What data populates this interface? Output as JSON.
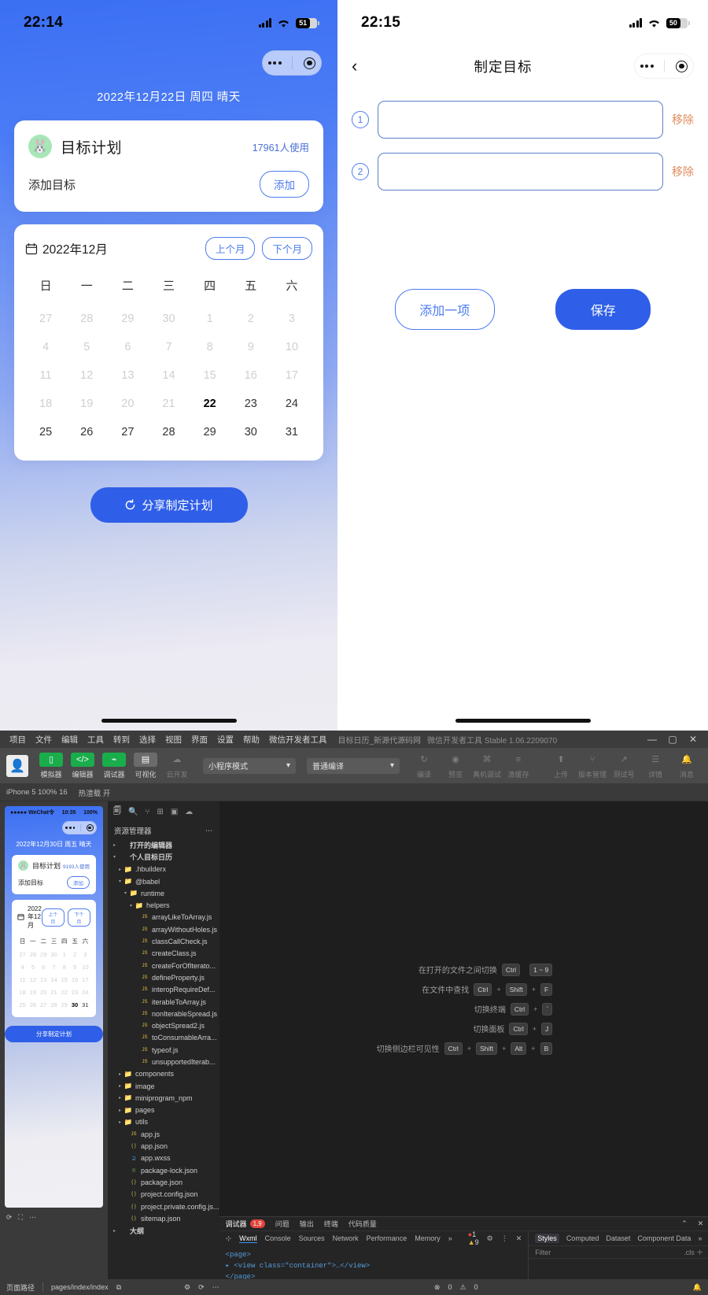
{
  "phone_left": {
    "status": {
      "time": "22:14",
      "battery": "51",
      "signal_icon": "signal-bars-icon",
      "wifi_icon": "wifi-icon"
    },
    "capsule": {
      "menu_icon": "more-dots-icon",
      "target_icon": "target-circle-icon"
    },
    "date_line": "2022年12月22日 周四 晴天",
    "goal_card": {
      "avatar_icon": "rabbit-avatar-icon",
      "title": "目标计划",
      "users": "17961人使用",
      "row_label": "添加目标",
      "add_button": "添加"
    },
    "calendar": {
      "icon": "calendar-icon",
      "month_label": "2022年12月",
      "prev_button": "上个月",
      "next_button": "下个月",
      "weekdays": [
        "日",
        "一",
        "二",
        "三",
        "四",
        "五",
        "六"
      ],
      "weeks": [
        [
          {
            "d": "27",
            "s": "muted"
          },
          {
            "d": "28",
            "s": "muted"
          },
          {
            "d": "29",
            "s": "muted"
          },
          {
            "d": "30",
            "s": "muted"
          },
          {
            "d": "1",
            "s": "muted"
          },
          {
            "d": "2",
            "s": "muted"
          },
          {
            "d": "3",
            "s": "muted"
          }
        ],
        [
          {
            "d": "4",
            "s": "muted"
          },
          {
            "d": "5",
            "s": "muted"
          },
          {
            "d": "6",
            "s": "muted"
          },
          {
            "d": "7",
            "s": "muted"
          },
          {
            "d": "8",
            "s": "muted"
          },
          {
            "d": "9",
            "s": "muted"
          },
          {
            "d": "10",
            "s": "muted"
          }
        ],
        [
          {
            "d": "11",
            "s": "muted"
          },
          {
            "d": "12",
            "s": "muted"
          },
          {
            "d": "13",
            "s": "muted"
          },
          {
            "d": "14",
            "s": "muted"
          },
          {
            "d": "15",
            "s": "muted"
          },
          {
            "d": "16",
            "s": "muted"
          },
          {
            "d": "17",
            "s": "muted"
          }
        ],
        [
          {
            "d": "18",
            "s": "muted"
          },
          {
            "d": "19",
            "s": "muted"
          },
          {
            "d": "20",
            "s": "muted"
          },
          {
            "d": "21",
            "s": "muted"
          },
          {
            "d": "22",
            "s": "today"
          },
          {
            "d": "23",
            "s": ""
          },
          {
            "d": "24",
            "s": ""
          }
        ],
        [
          {
            "d": "25",
            "s": ""
          },
          {
            "d": "26",
            "s": ""
          },
          {
            "d": "27",
            "s": ""
          },
          {
            "d": "28",
            "s": ""
          },
          {
            "d": "29",
            "s": ""
          },
          {
            "d": "30",
            "s": ""
          },
          {
            "d": "31",
            "s": ""
          }
        ]
      ]
    },
    "share_button": {
      "label": "分享制定计划",
      "icon": "refresh-icon"
    },
    "home_indicator": "home-indicator"
  },
  "phone_right": {
    "status": {
      "time": "22:15",
      "battery": "50",
      "signal_icon": "signal-bars-icon",
      "wifi_icon": "wifi-icon"
    },
    "nav": {
      "back_icon": "chevron-left-icon",
      "title": "制定目标",
      "menu_icon": "more-dots-icon",
      "target_icon": "target-circle-icon"
    },
    "goals": [
      {
        "number": "①",
        "value": "",
        "placeholder": "",
        "remove_label": "移除"
      },
      {
        "number": "②",
        "value": "",
        "placeholder": "",
        "remove_label": "移除"
      }
    ],
    "add_item_button": "添加一项",
    "save_button": "保存",
    "home_indicator": "home-indicator"
  },
  "ide": {
    "menubar": {
      "items": [
        "项目",
        "文件",
        "编辑",
        "工具",
        "转到",
        "选择",
        "视图",
        "界面",
        "设置",
        "帮助",
        "微信开发者工具"
      ],
      "project_name": "目标日历_新源代源码网",
      "window_title": "微信开发者工具 Stable 1.06.2209070",
      "minimize": "—",
      "maximize": "▢",
      "close": "✕"
    },
    "toolbar": {
      "avatar_icon": "user-avatar-icon",
      "left_items": [
        {
          "label": "模拟器",
          "icon": "phone-icon",
          "style": "green",
          "glyph": "▯"
        },
        {
          "label": "编辑器",
          "icon": "code-icon",
          "style": "green",
          "glyph": "</>"
        },
        {
          "label": "调试器",
          "icon": "debug-icon",
          "style": "green",
          "glyph": "⌁"
        },
        {
          "label": "可视化",
          "icon": "layout-icon",
          "style": "grey",
          "glyph": "▤"
        },
        {
          "label": "云开发",
          "icon": "cloud-icon",
          "style": "flat",
          "glyph": "☁"
        }
      ],
      "mode_select": "小程序模式",
      "compile_select": "普通编译",
      "mid_items": [
        {
          "label": "编译",
          "icon": "compile-refresh-icon",
          "glyph": "↻"
        },
        {
          "label": "预览",
          "icon": "preview-eye-icon",
          "glyph": "◉"
        },
        {
          "label": "真机调试",
          "icon": "device-debug-icon",
          "glyph": "⌘"
        },
        {
          "label": "清缓存",
          "icon": "clear-cache-icon",
          "glyph": "≡"
        }
      ],
      "right_items": [
        {
          "label": "上传",
          "icon": "upload-icon",
          "glyph": "⬆"
        },
        {
          "label": "版本管理",
          "icon": "branch-icon",
          "glyph": "⑂"
        },
        {
          "label": "测试号",
          "icon": "external-link-icon",
          "glyph": "↗"
        },
        {
          "label": "详情",
          "icon": "details-icon",
          "glyph": "☰"
        },
        {
          "label": "消息",
          "icon": "bell-icon",
          "glyph": "🔔"
        }
      ]
    },
    "subbar": {
      "device": "iPhone 5 100% 16",
      "screenshot": "热渲载 开"
    },
    "simulator": {
      "status": {
        "carrier": "●●●●● WeChat令",
        "time": "10:35",
        "battery": "100%"
      },
      "date_line": "2022年12月30日 周五 晴天",
      "card": {
        "title": "目标计划",
        "users": "9193人使用",
        "row_label": "添加目标",
        "add_button": "添加"
      },
      "calendar": {
        "month_label": "2022年12月",
        "prev_button": "上个月",
        "next_button": "下个月",
        "weekdays": [
          "日",
          "一",
          "二",
          "三",
          "四",
          "五",
          "六"
        ],
        "weeks": [
          [
            {
              "d": "27",
              "s": "muted"
            },
            {
              "d": "28",
              "s": "muted"
            },
            {
              "d": "29",
              "s": "muted"
            },
            {
              "d": "30",
              "s": "muted"
            },
            {
              "d": "1",
              "s": "muted"
            },
            {
              "d": "2",
              "s": "muted"
            },
            {
              "d": "3",
              "s": "muted"
            }
          ],
          [
            {
              "d": "4",
              "s": "muted"
            },
            {
              "d": "5",
              "s": "muted"
            },
            {
              "d": "6",
              "s": "muted"
            },
            {
              "d": "7",
              "s": "muted"
            },
            {
              "d": "8",
              "s": "muted"
            },
            {
              "d": "9",
              "s": "muted"
            },
            {
              "d": "10",
              "s": "muted"
            }
          ],
          [
            {
              "d": "11",
              "s": "muted"
            },
            {
              "d": "12",
              "s": "muted"
            },
            {
              "d": "13",
              "s": "muted"
            },
            {
              "d": "14",
              "s": "muted"
            },
            {
              "d": "15",
              "s": "muted"
            },
            {
              "d": "16",
              "s": "muted"
            },
            {
              "d": "17",
              "s": "muted"
            }
          ],
          [
            {
              "d": "18",
              "s": "muted"
            },
            {
              "d": "19",
              "s": "muted"
            },
            {
              "d": "20",
              "s": "muted"
            },
            {
              "d": "21",
              "s": "muted"
            },
            {
              "d": "22",
              "s": "muted"
            },
            {
              "d": "23",
              "s": "muted"
            },
            {
              "d": "24",
              "s": "muted"
            }
          ],
          [
            {
              "d": "25",
              "s": "muted"
            },
            {
              "d": "26",
              "s": "muted"
            },
            {
              "d": "27",
              "s": "muted"
            },
            {
              "d": "28",
              "s": "muted"
            },
            {
              "d": "29",
              "s": "muted"
            },
            {
              "d": "30",
              "s": "today"
            },
            {
              "d": "31",
              "s": ""
            }
          ]
        ]
      },
      "share_button": "分享制定计划"
    },
    "explorer": {
      "icons": [
        "files-icon",
        "search-icon",
        "source-control-icon",
        "extensions-icon",
        "debug-panel-icon",
        "cloud-icon"
      ],
      "title": "资源管理器",
      "more_icon": "more-dots-icon",
      "tree": [
        {
          "depth": 0,
          "arrow": "▸",
          "icon": "",
          "name": "打开的编辑器",
          "type": "section"
        },
        {
          "depth": 0,
          "arrow": "▾",
          "icon": "",
          "name": "个人目标日历",
          "type": "section"
        },
        {
          "depth": 1,
          "arrow": "▸",
          "icon": "folder-icon",
          "name": ".hbuilderx",
          "type": "folder"
        },
        {
          "depth": 1,
          "arrow": "▾",
          "icon": "folder-open-icon",
          "name": "@babel",
          "type": "folder"
        },
        {
          "depth": 2,
          "arrow": "▾",
          "icon": "folder-open-icon",
          "name": "runtime",
          "type": "folder"
        },
        {
          "depth": 3,
          "arrow": "▾",
          "icon": "folder-open-icon",
          "name": "helpers",
          "type": "folder"
        },
        {
          "depth": 4,
          "arrow": "",
          "icon": "js-file-icon",
          "name": "arrayLikeToArray.js",
          "type": "js"
        },
        {
          "depth": 4,
          "arrow": "",
          "icon": "js-file-icon",
          "name": "arrayWithoutHoles.js",
          "type": "js"
        },
        {
          "depth": 4,
          "arrow": "",
          "icon": "js-file-icon",
          "name": "classCallCheck.js",
          "type": "js"
        },
        {
          "depth": 4,
          "arrow": "",
          "icon": "js-file-icon",
          "name": "createClass.js",
          "type": "js"
        },
        {
          "depth": 4,
          "arrow": "",
          "icon": "js-file-icon",
          "name": "createForOfIterato...",
          "type": "js"
        },
        {
          "depth": 4,
          "arrow": "",
          "icon": "js-file-icon",
          "name": "defineProperty.js",
          "type": "js"
        },
        {
          "depth": 4,
          "arrow": "",
          "icon": "js-file-icon",
          "name": "interopRequireDef...",
          "type": "js"
        },
        {
          "depth": 4,
          "arrow": "",
          "icon": "js-file-icon",
          "name": "iterableToArray.js",
          "type": "js"
        },
        {
          "depth": 4,
          "arrow": "",
          "icon": "js-file-icon",
          "name": "nonIterableSpread.js",
          "type": "js"
        },
        {
          "depth": 4,
          "arrow": "",
          "icon": "js-file-icon",
          "name": "objectSpread2.js",
          "type": "js"
        },
        {
          "depth": 4,
          "arrow": "",
          "icon": "js-file-icon",
          "name": "toConsumableArra...",
          "type": "js"
        },
        {
          "depth": 4,
          "arrow": "",
          "icon": "js-file-icon",
          "name": "typeof.js",
          "type": "js"
        },
        {
          "depth": 4,
          "arrow": "",
          "icon": "js-file-icon",
          "name": "unsupportedIterab...",
          "type": "js"
        },
        {
          "depth": 1,
          "arrow": "▸",
          "icon": "folder-icon",
          "name": "components",
          "type": "folder"
        },
        {
          "depth": 1,
          "arrow": "▸",
          "icon": "folder-icon",
          "name": "image",
          "type": "folder"
        },
        {
          "depth": 1,
          "arrow": "▸",
          "icon": "folder-icon",
          "name": "miniprogram_npm",
          "type": "folder"
        },
        {
          "depth": 1,
          "arrow": "▸",
          "icon": "folder-icon",
          "name": "pages",
          "type": "folder"
        },
        {
          "depth": 1,
          "arrow": "▸",
          "icon": "folder-icon",
          "name": "utils",
          "type": "folder"
        },
        {
          "depth": 2,
          "arrow": "",
          "icon": "js-file-icon",
          "name": "app.js",
          "type": "js"
        },
        {
          "depth": 2,
          "arrow": "",
          "icon": "json-file-icon",
          "name": "app.json",
          "type": "json"
        },
        {
          "depth": 2,
          "arrow": "",
          "icon": "wxss-file-icon",
          "name": "app.wxss",
          "type": "wxss"
        },
        {
          "depth": 2,
          "arrow": "",
          "icon": "lock-file-icon",
          "name": "package-lock.json",
          "type": "lock"
        },
        {
          "depth": 2,
          "arrow": "",
          "icon": "json-file-icon",
          "name": "package.json",
          "type": "json"
        },
        {
          "depth": 2,
          "arrow": "",
          "icon": "config-file-icon",
          "name": "project.config.json",
          "type": "cfg"
        },
        {
          "depth": 2,
          "arrow": "",
          "icon": "config-file-icon",
          "name": "project.private.config.js...",
          "type": "cfg"
        },
        {
          "depth": 2,
          "arrow": "",
          "icon": "map-file-icon",
          "name": "sitemap.json",
          "type": "map"
        },
        {
          "depth": 0,
          "arrow": "▸",
          "icon": "",
          "name": "大纲",
          "type": "section"
        }
      ]
    },
    "editor_welcome": {
      "rows": [
        {
          "label": "在打开的文件之间切换",
          "keys": [
            "Ctrl",
            "1 ~ 9"
          ],
          "seps": [
            ""
          ]
        },
        {
          "label": "在文件中查找",
          "keys": [
            "Ctrl",
            "Shift",
            "F"
          ],
          "seps": [
            "+",
            "+"
          ]
        },
        {
          "label": "切换终端",
          "keys": [
            "Ctrl",
            "`"
          ],
          "seps": [
            "+"
          ]
        },
        {
          "label": "切换面板",
          "keys": [
            "Ctrl",
            "J"
          ],
          "seps": [
            "+"
          ]
        },
        {
          "label": "切换侧边栏可见性",
          "keys": [
            "Ctrl",
            "Shift",
            "Alt",
            "B"
          ],
          "seps": [
            "+",
            "+",
            "+"
          ]
        }
      ]
    },
    "devtools": {
      "top_tabs": [
        {
          "label": "调试器",
          "badge": "1,9"
        },
        {
          "label": "问题",
          "badge": ""
        },
        {
          "label": "输出",
          "badge": ""
        },
        {
          "label": "终端",
          "badge": ""
        },
        {
          "label": "代码质量",
          "badge": ""
        }
      ],
      "collapse_icon": "chevron-up-icon",
      "close_icon": "close-icon",
      "inspect_icon": "inspect-element-icon",
      "tabs": [
        "Wxml",
        "Console",
        "Sources",
        "Network",
        "Performance",
        "Memory"
      ],
      "tabs_selected": "Wxml",
      "tabs_overflow": "»",
      "error_count": "1",
      "warn_count": "9",
      "settings_icon": "gear-icon",
      "kebab_icon": "kebab-menu-icon",
      "dt_close_icon": "close-icon",
      "code_lines": [
        "<page>",
        "▸ <view class=\"container\">…</view>",
        "</page>"
      ],
      "right_tabs": [
        "Styles",
        "Computed",
        "Dataset",
        "Component Data"
      ],
      "right_tabs_selected": "Styles",
      "right_overflow": "»",
      "filter_placeholder": "Filter",
      "cls_label": ".cls",
      "add_icon": "plus-icon"
    },
    "statusbar": {
      "left": "页面路径",
      "path": "pages/index/index",
      "copy_icon": "copy-icon",
      "gear_icon": "gear-icon",
      "sync_icon": "sync-icon",
      "more_icon": "more-dots-icon",
      "errors": "0",
      "warnings": "0",
      "error_icon": "error-circle-icon",
      "warn_icon": "warning-triangle-icon",
      "right_icon": "bell-icon"
    }
  },
  "colors": {
    "brand_blue": "#2f5fe8",
    "outline_blue": "#4c7bf0",
    "orange": "#e08a5c",
    "wechat_green": "#1aad4b",
    "ide_bg": "#1e1e1e"
  }
}
